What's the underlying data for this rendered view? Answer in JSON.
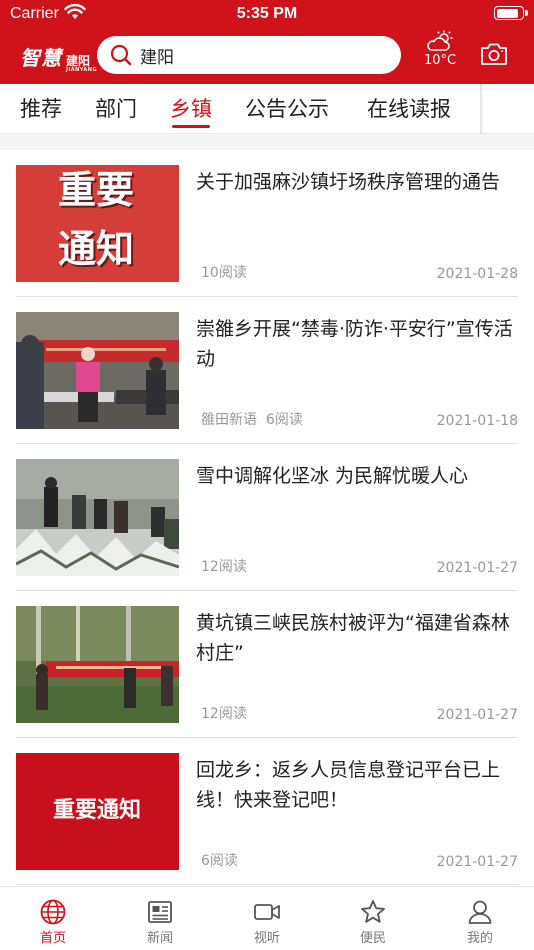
{
  "status_bar": {
    "carrier": "Carrier",
    "time": "5:35 PM",
    "battery_level": 0.9
  },
  "header": {
    "logo_main": "智慧",
    "logo_city": "建阳",
    "logo_pinyin": "JIANYANG",
    "search_value": "建阳",
    "temperature": "10°C",
    "brand_color": "#d0121b"
  },
  "tabs": [
    {
      "label": "推荐",
      "active": false
    },
    {
      "label": "部门",
      "active": false
    },
    {
      "label": "乡镇",
      "active": true
    },
    {
      "label": "公告公示",
      "active": false
    },
    {
      "label": "在线读报",
      "active": false
    }
  ],
  "news": [
    {
      "title": "关于加强麻沙镇圩场秩序管理的通告",
      "source": "",
      "reads": "10阅读",
      "date": "2021-01-28",
      "thumb_text": [
        "重要",
        "通知"
      ]
    },
    {
      "title": "崇雒乡开展“禁毒·防诈·平安行”宣传活动",
      "source": "雒田新语",
      "reads": "6阅读",
      "date": "2021-01-18",
      "thumb_text": []
    },
    {
      "title": "雪中调解化坚冰 为民解忧暖人心",
      "source": "",
      "reads": "12阅读",
      "date": "2021-01-27",
      "thumb_text": []
    },
    {
      "title": "黄坑镇三峡民族村被评为“福建省森林村庄”",
      "source": "",
      "reads": "12阅读",
      "date": "2021-01-27",
      "thumb_text": []
    },
    {
      "title": "回龙乡：返乡人员信息登记平台已上线！快来登记吧！",
      "source": "",
      "reads": "6阅读",
      "date": "2021-01-27",
      "thumb_text": [
        "重要通知"
      ]
    }
  ],
  "tabbar": [
    {
      "label": "首页",
      "icon": "globe-icon",
      "active": true
    },
    {
      "label": "新闻",
      "icon": "newspaper-icon",
      "active": false
    },
    {
      "label": "视听",
      "icon": "video-icon",
      "active": false
    },
    {
      "label": "便民",
      "icon": "star-icon",
      "active": false
    },
    {
      "label": "我的",
      "icon": "user-icon",
      "active": false
    }
  ]
}
